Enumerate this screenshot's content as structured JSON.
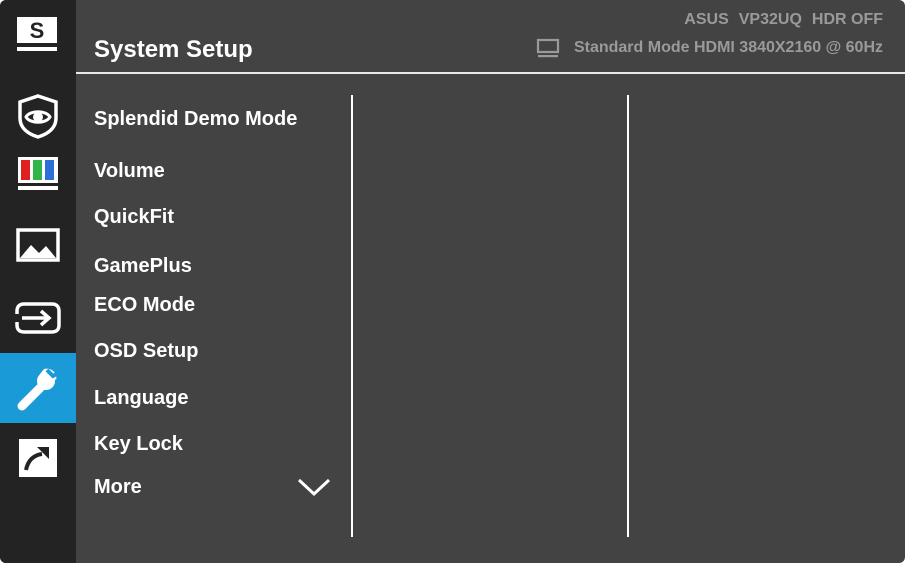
{
  "header": {
    "title": "System Setup",
    "brand": "ASUS",
    "model": "VP32UQ",
    "hdr": "HDR OFF",
    "mode_info": "Standard Mode HDMI 3840X2160 @ 60Hz"
  },
  "sidebar": {
    "items": [
      {
        "icon": "splendid-s-icon"
      },
      {
        "icon": "eye-care-icon"
      },
      {
        "icon": "color-bars-icon"
      },
      {
        "icon": "image-icon"
      },
      {
        "icon": "input-select-icon"
      },
      {
        "icon": "wrench-icon",
        "active": true
      },
      {
        "icon": "shortcut-arrow-icon"
      }
    ],
    "active_color": "#1a9ad6"
  },
  "menu": {
    "items": [
      {
        "label": "Splendid Demo Mode"
      },
      {
        "label": "Volume"
      },
      {
        "label": "QuickFit"
      },
      {
        "label": "GamePlus"
      },
      {
        "label": "ECO Mode"
      },
      {
        "label": "OSD Setup"
      },
      {
        "label": "Language"
      },
      {
        "label": "Key Lock"
      },
      {
        "label": "More"
      }
    ],
    "more_icon": "chevron-down-icon"
  },
  "colors": {
    "panel": "#434343",
    "sidebar": "#232323",
    "status_text": "#9a9a9a",
    "text": "#ffffff"
  }
}
